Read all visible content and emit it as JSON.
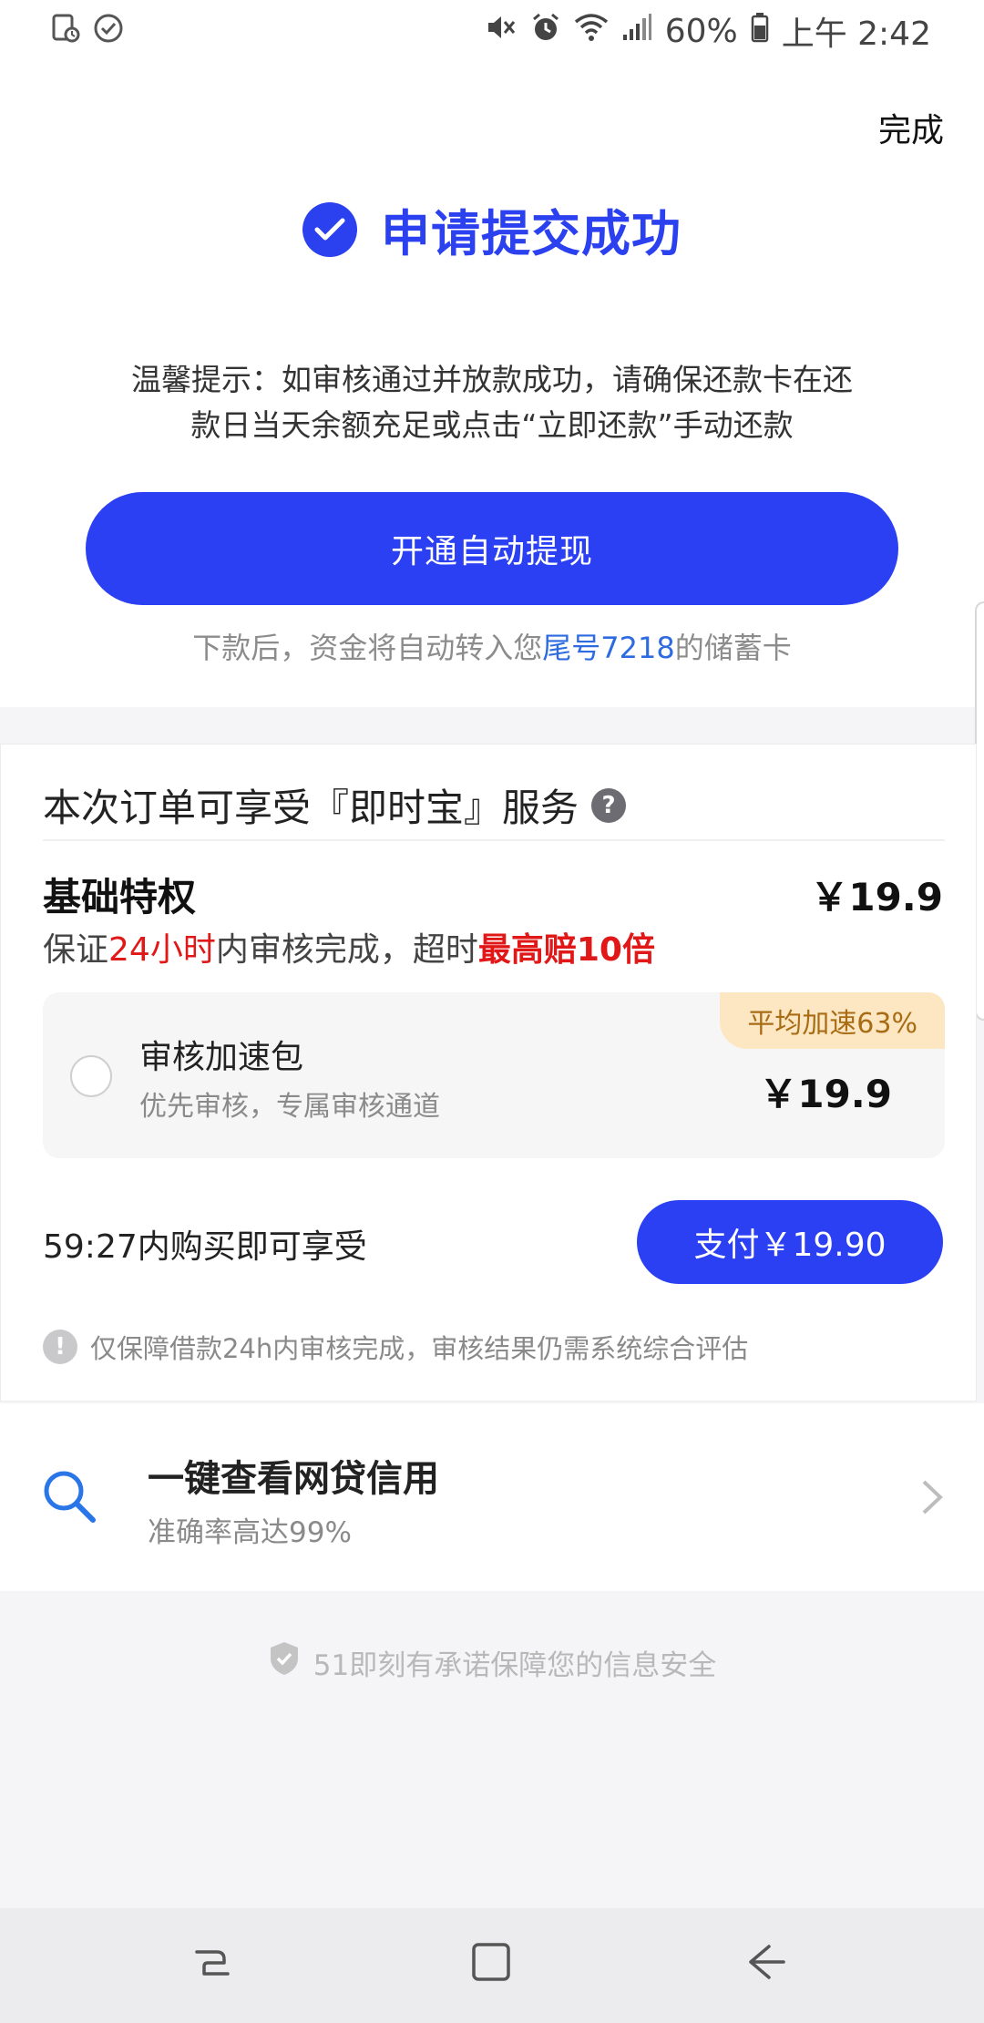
{
  "status_bar": {
    "left_icons": [
      "sim-storage-icon",
      "check-circle-icon"
    ],
    "right_icons": [
      "mute-icon",
      "alarm-icon",
      "wifi-icon",
      "signal-icon",
      "battery-icon"
    ],
    "battery": "60%",
    "time": "上午 2:42"
  },
  "header": {
    "done_label": "完成"
  },
  "success": {
    "title": "申请提交成功",
    "tip_line1": "温馨提示：如审核通过并放款成功，请确保还款卡在还",
    "tip_line2": "款日当天余额充足或点击“立即还款”手动还款",
    "cta_label": "开通自动提现",
    "note_prefix": "下款后，资金将自动转入您",
    "note_highlight": "尾号7218",
    "note_suffix": "的储蓄卡"
  },
  "service": {
    "title": "本次订单可享受『即时宝』服务",
    "help_glyph": "?",
    "basic": {
      "name": "基础特权",
      "price": "￥19.9",
      "desc_1": "保证",
      "desc_red": "24小时",
      "desc_2": "内审核完成，超时",
      "desc_bold": "最高赔10倍"
    },
    "package": {
      "name": "审核加速包",
      "subtitle": "优先审核，专属审核通道",
      "price": "￥19.9",
      "badge": "平均加速63%",
      "selected": false
    },
    "timer_text": "59:27内购买即可享受",
    "pay_label": "支付￥19.90",
    "notice_glyph": "!",
    "notice": "仅保障借款24h内审核完成，审核结果仍需系统综合评估"
  },
  "credit": {
    "title": "一键查看网贷信用",
    "subtitle": "准确率高达99%"
  },
  "security": {
    "text": "51即刻有承诺保障您的信息安全"
  },
  "colors": {
    "accent": "#2b40f2",
    "red": "#e01818",
    "badge_bg": "#fde6c2",
    "badge_text": "#a86d14"
  }
}
